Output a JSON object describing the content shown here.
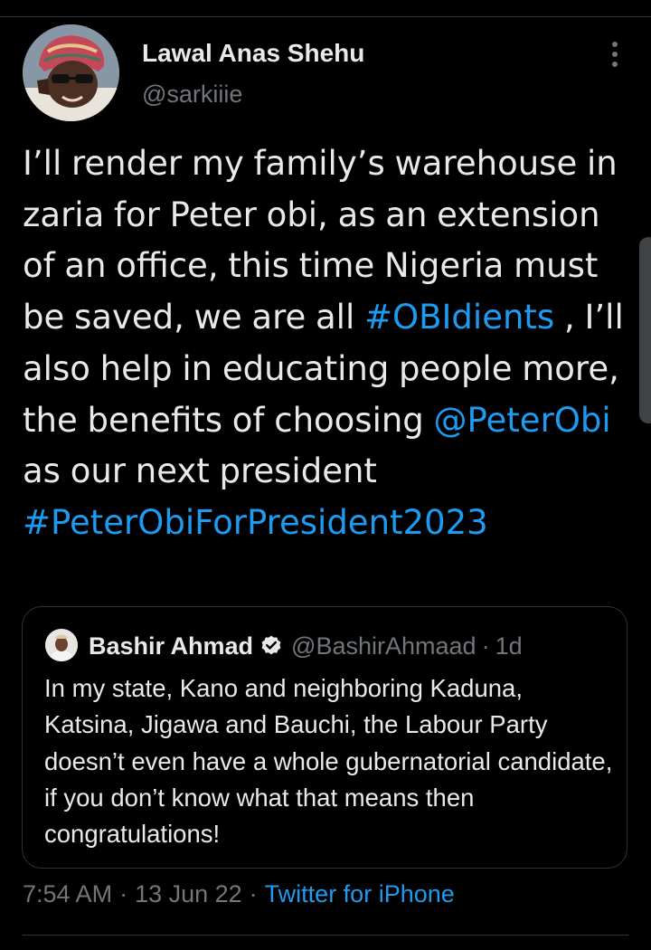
{
  "tweet": {
    "author_name": "Lawal Anas Shehu",
    "author_handle": "@sarkiiie",
    "text_segments": [
      {
        "text": "I’ll render my family’s warehouse in zaria for Peter obi, as an extension of an office, this time Nigeria must be saved, we are all ",
        "type": "text"
      },
      {
        "text": "#OBIdients",
        "type": "hashtag"
      },
      {
        "text": " , I’ll also help in educating people more, the benefits of choosing ",
        "type": "text"
      },
      {
        "text": "@PeterObi",
        "type": "mention"
      },
      {
        "text": " as our next president ",
        "type": "text"
      },
      {
        "text": "#PeterObiForPresident2023",
        "type": "hashtag"
      }
    ],
    "time": "7:54 AM",
    "separator": "·",
    "date": "13 Jun 22",
    "source": "Twitter for iPhone"
  },
  "quote": {
    "name": "Bashir Ahmad",
    "handle": "@BashirAhmaad",
    "separator": "·",
    "time": "1d",
    "text": "In my state, Kano and neighboring Kaduna, Katsina, Jigawa and Bauchi, the Labour Party doesn’t even have a whole gubernatorial candidate, if you don’t know what that means then congratulations!"
  },
  "icons": {
    "more": "more-vertical-icon",
    "verified": "verified-badge-icon"
  },
  "colors": {
    "background": "#000000",
    "text": "#e7e9ea",
    "secondary": "#71767b",
    "link": "#1d9bf0",
    "border": "#2f3336"
  }
}
